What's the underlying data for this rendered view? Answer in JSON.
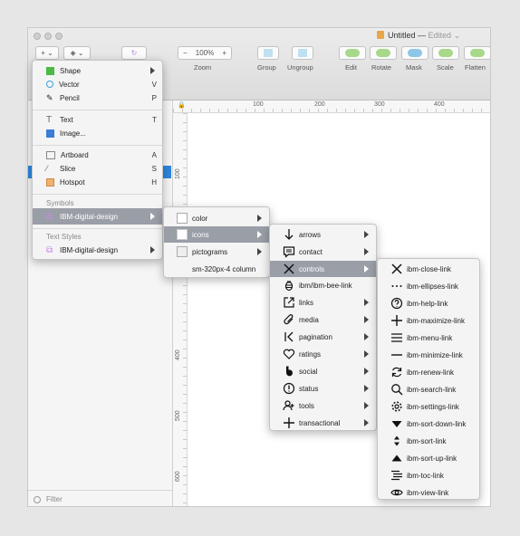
{
  "window": {
    "title": "Untitled",
    "status": "Edited"
  },
  "toolbar": {
    "insert_label": "+",
    "zoom_value": "100%",
    "zoom_minus": "−",
    "zoom_plus": "+",
    "labels": {
      "zoom": "Zoom",
      "group": "Group",
      "ungroup": "Ungroup",
      "edit": "Edit",
      "rotate": "Rotate",
      "mask": "Mask",
      "scale": "Scale",
      "flatten": "Flatten"
    }
  },
  "ruler": {
    "top": [
      "100",
      "200",
      "300",
      "400"
    ],
    "left": [
      "100",
      "200",
      "400",
      "500",
      "600"
    ]
  },
  "sidebar": {
    "filter_placeholder": "Filter"
  },
  "insert_menu": {
    "items": [
      {
        "label": "Shape",
        "shortcut": ""
      },
      {
        "label": "Vector",
        "shortcut": "V"
      },
      {
        "label": "Pencil",
        "shortcut": "P"
      },
      {
        "label": "Text",
        "shortcut": "T"
      },
      {
        "label": "Image...",
        "shortcut": ""
      },
      {
        "label": "Artboard",
        "shortcut": "A"
      },
      {
        "label": "Slice",
        "shortcut": "S"
      },
      {
        "label": "Hotspot",
        "shortcut": "H"
      }
    ],
    "symbols_header": "Symbols",
    "symbols_item": "IBM-digital-design",
    "text_styles_header": "Text Styles",
    "text_styles_item": "IBM-digital-design"
  },
  "library_menu": {
    "items": [
      "color",
      "icons",
      "pictograms",
      "sm-320px-4 column"
    ]
  },
  "icons_menu": {
    "items": [
      "arrows",
      "contact",
      "controls",
      "ibm/ibm-bee-link",
      "links",
      "media",
      "pagination",
      "ratings",
      "social",
      "status",
      "tools",
      "transactional"
    ]
  },
  "controls_menu": {
    "items": [
      "ibm-close-link",
      "ibm-ellipses-link",
      "ibm-help-link",
      "ibm-maximize-link",
      "ibm-menu-link",
      "ibm-minimize-link",
      "ibm-renew-link",
      "ibm-search-link",
      "ibm-settings-link",
      "ibm-sort-down-link",
      "ibm-sort-link",
      "ibm-sort-up-link",
      "ibm-toc-link",
      "ibm-view-link"
    ]
  },
  "colors": {
    "highlight": "#9a9ea7",
    "selection": "#2e86de",
    "shape_green": "#4cba43",
    "hotspot_orange": "#f0b070"
  }
}
